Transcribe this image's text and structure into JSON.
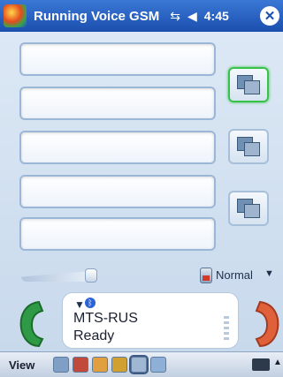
{
  "titlebar": {
    "app_title": "Running Voice GSM",
    "time": "4:45",
    "close_label": "✕"
  },
  "status": {
    "operator": "MTS-RUS",
    "state": "Ready"
  },
  "mode": {
    "label": "Normal",
    "arrow": "▼"
  },
  "bottombar": {
    "view_label": "View"
  },
  "colors": {
    "titlebar": "#1b4fae",
    "accent_green": "#39c24a",
    "call_green": "#2e9a45",
    "end_red": "#e0603a"
  },
  "icons": [
    "start-icon",
    "connectivity-icon",
    "volume-icon",
    "close-icon",
    "signal-icon",
    "bluetooth-icon",
    "speaker-mode-icon",
    "call-icon",
    "end-call-icon",
    "keyboard-icon"
  ]
}
